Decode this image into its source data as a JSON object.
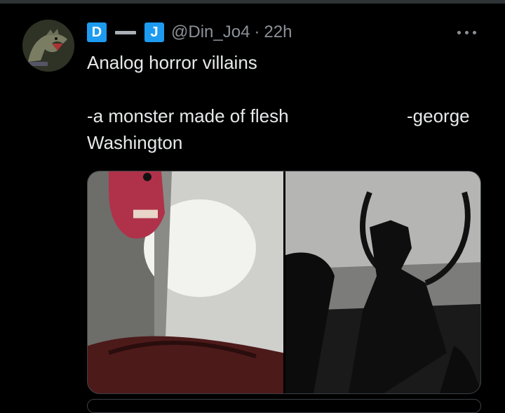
{
  "tweet": {
    "author_badge_1": "D",
    "author_badge_2": "J",
    "handle": "@Din_Jo4",
    "separator": "·",
    "time": "22h",
    "text_line1": "Analog horror villains",
    "text_line2a": "-a monster made of flesh",
    "text_line2b": "-george",
    "text_line3": "Washington",
    "avatar_icon": "dinosaur-avatar",
    "more_icon": "more-options-icon"
  },
  "media": {
    "left_image": "monster-photo",
    "right_image": "george-washington-photo"
  },
  "colors": {
    "background": "#000000",
    "text": "#e7e9ea",
    "muted": "#8b9197",
    "badge": "#1d9bf0",
    "border": "#3b4045"
  }
}
